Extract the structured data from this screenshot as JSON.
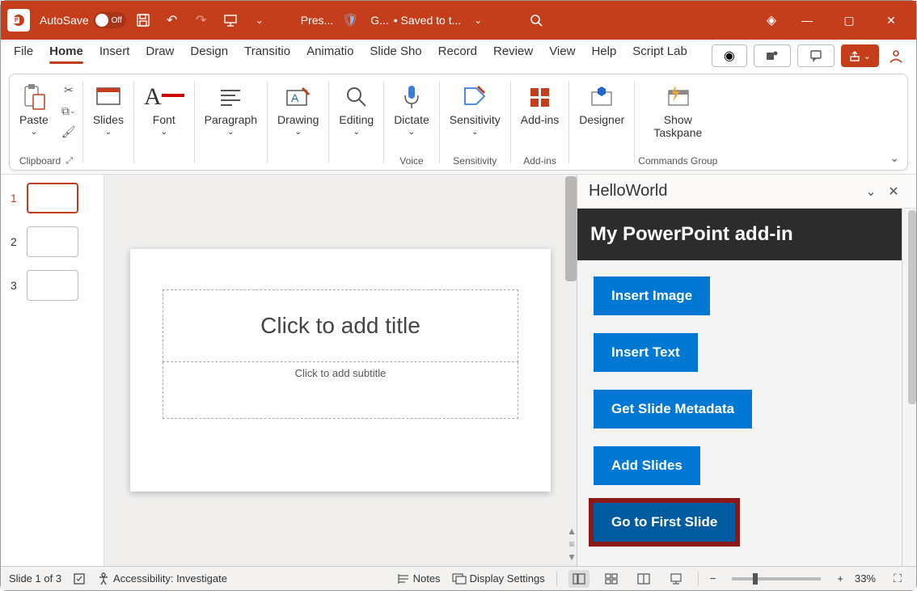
{
  "titlebar": {
    "autosave_label": "AutoSave",
    "autosave_state": "Off",
    "doc_name": "Pres...",
    "sensitivity_short": "G...",
    "saved_text": "• Saved to t...",
    "search_icon": "search"
  },
  "tabs": {
    "items": [
      "File",
      "Home",
      "Insert",
      "Draw",
      "Design",
      "Transitio",
      "Animatio",
      "Slide Sho",
      "Record",
      "Review",
      "View",
      "Help",
      "Script Lab"
    ],
    "active_index": 1
  },
  "ribbon": {
    "clipboard": {
      "paste": "Paste",
      "label": "Clipboard"
    },
    "slides": {
      "label": "Slides"
    },
    "font": {
      "label": "Font"
    },
    "paragraph": {
      "label": "Paragraph"
    },
    "drawing": {
      "label": "Drawing"
    },
    "editing": {
      "label": "Editing"
    },
    "dictate": {
      "label": "Dictate",
      "group": "Voice"
    },
    "sensitivity": {
      "label": "Sensitivity",
      "group": "Sensitivity"
    },
    "addins": {
      "label": "Add-ins",
      "group": "Add-ins"
    },
    "designer": {
      "label": "Designer"
    },
    "showtaskpane": {
      "label1": "Show",
      "label2": "Taskpane",
      "group": "Commands Group"
    }
  },
  "thumbnails": {
    "count": 3,
    "selected": 1
  },
  "slide": {
    "title_placeholder": "Click to add title",
    "subtitle_placeholder": "Click to add subtitle"
  },
  "taskpane": {
    "title": "HelloWorld",
    "addin_header": "My PowerPoint add-in",
    "buttons": [
      "Insert Image",
      "Insert Text",
      "Get Slide Metadata",
      "Add Slides",
      "Go to First Slide"
    ],
    "highlighted_index": 4
  },
  "statusbar": {
    "slide_text": "Slide 1 of 3",
    "accessibility": "Accessibility: Investigate",
    "notes": "Notes",
    "display_settings": "Display Settings",
    "zoom_pct": "33%"
  }
}
